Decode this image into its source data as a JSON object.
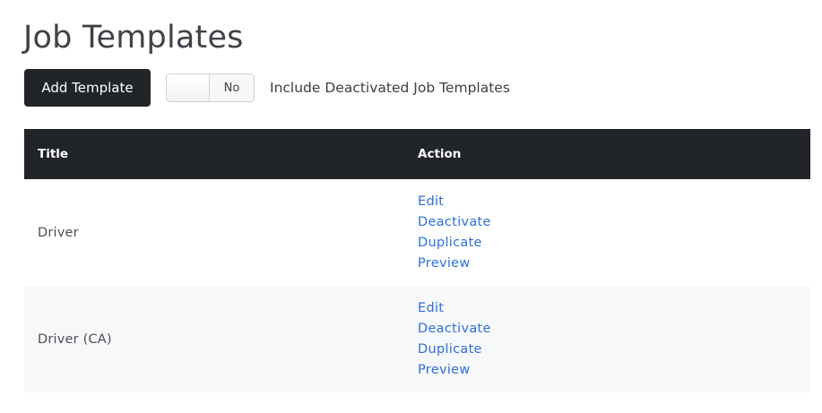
{
  "page": {
    "title": "Job Templates"
  },
  "toolbar": {
    "add_label": "Add Template",
    "toggle_value": "No",
    "toggle_label": "Include Deactivated Job Templates"
  },
  "table": {
    "headers": [
      "Title",
      "Action"
    ],
    "rows": [
      {
        "title": "Driver",
        "actions": [
          "Edit",
          "Deactivate",
          "Duplicate",
          "Preview"
        ]
      },
      {
        "title": "Driver (CA)",
        "actions": [
          "Edit",
          "Deactivate",
          "Duplicate",
          "Preview"
        ]
      }
    ]
  },
  "colors": {
    "header_bg": "#212428",
    "link": "#2f6fd6",
    "alt_row_bg": "#f7f8fa"
  }
}
